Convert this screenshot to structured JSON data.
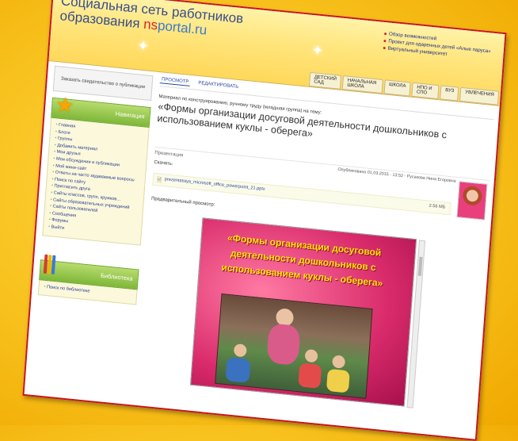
{
  "header": {
    "title_line1": "Социальная сеть работников",
    "title_line2": "образования ",
    "brand_ns": "ns",
    "brand_rest": "portal.ru",
    "top_links": [
      "Обзор возможностей",
      "Проект для одаренных детей «Алые паруса»",
      "Виртуальный университет"
    ],
    "nav_tabs": [
      "ДЕТСКИЙ САД",
      "НАЧАЛЬНАЯ ШКОЛА",
      "ШКОЛА",
      "НПО И СПО",
      "ВУЗ",
      "УВЛЕЧЕНИЯ"
    ]
  },
  "sidebar": {
    "cert_button": "Заказать свидетельство о публикации",
    "nav_title": "Навигация",
    "nav_items": [
      "Главная",
      "Блоги",
      "Группы",
      "Добавить материал",
      "Мои друзья",
      "Мои обсуждения и публикации",
      "Мой мини-сайт",
      "Ответы на часто задаваемые вопросы",
      "Поиск по сайту",
      "Пригласить друга",
      "Сайты классов, групп, кружков...",
      "Сайты образовательных учреждений",
      "Сайты пользователей",
      "Сообщения",
      "Форумы",
      "Выйти"
    ],
    "library_title": "Библиотека",
    "library_items": [
      "Поиск по библиотеке"
    ]
  },
  "main": {
    "tabs": [
      "ПРОСМОТР",
      "РЕДАКТИРОВАТЬ"
    ],
    "material_line": "Материал по конструированию, ручному труду (младшая группа) на тему:",
    "title": "«Формы организации досуговой деятельности дошкольников с использованием куклы - оберега»",
    "section_label": "Презентация",
    "published": "Опубликовано 01.03.2015 - 13:52 - Русакова Нина Егоровна",
    "download_label": "Скачать:",
    "file_name": "prezentatsiya_microsoft_office_powerpoint_21.pptx",
    "file_size": "2.56 МБ",
    "preview_label": "Предварительный просмотр:",
    "slide_title": "«Формы организации досуговой деятельности дошкольников с использованием куклы - оберега»"
  },
  "colors": {
    "frame_border": "#c8141b",
    "nav_green": "#7eb738",
    "link_blue": "#2a4aa0",
    "slide_yellow": "#ffe600"
  }
}
